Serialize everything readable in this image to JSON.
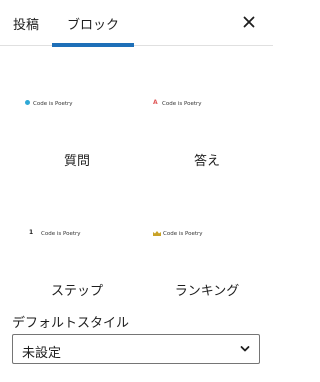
{
  "tabs": [
    {
      "label": "投稿"
    },
    {
      "label": "ブロック"
    }
  ],
  "styles": [
    {
      "label": "質問",
      "preview_text": "Code is Poetry"
    },
    {
      "label": "答え",
      "preview_text": "Code is Poetry",
      "marker": "A"
    },
    {
      "label": "ステップ",
      "preview_text": "Code is Poetry",
      "marker": "1"
    },
    {
      "label": "ランキング",
      "preview_text": "Code is Poetry"
    }
  ],
  "default_style": {
    "label": "デフォルトスタイル",
    "value": "未設定"
  },
  "icons": {
    "close": "close-icon",
    "chevron": "chevron-down-icon"
  },
  "colors": {
    "accent": "#1e6fb8",
    "dot": "#2ea8d6",
    "answer_marker": "#e05a5a",
    "crown": "#c9a227"
  }
}
